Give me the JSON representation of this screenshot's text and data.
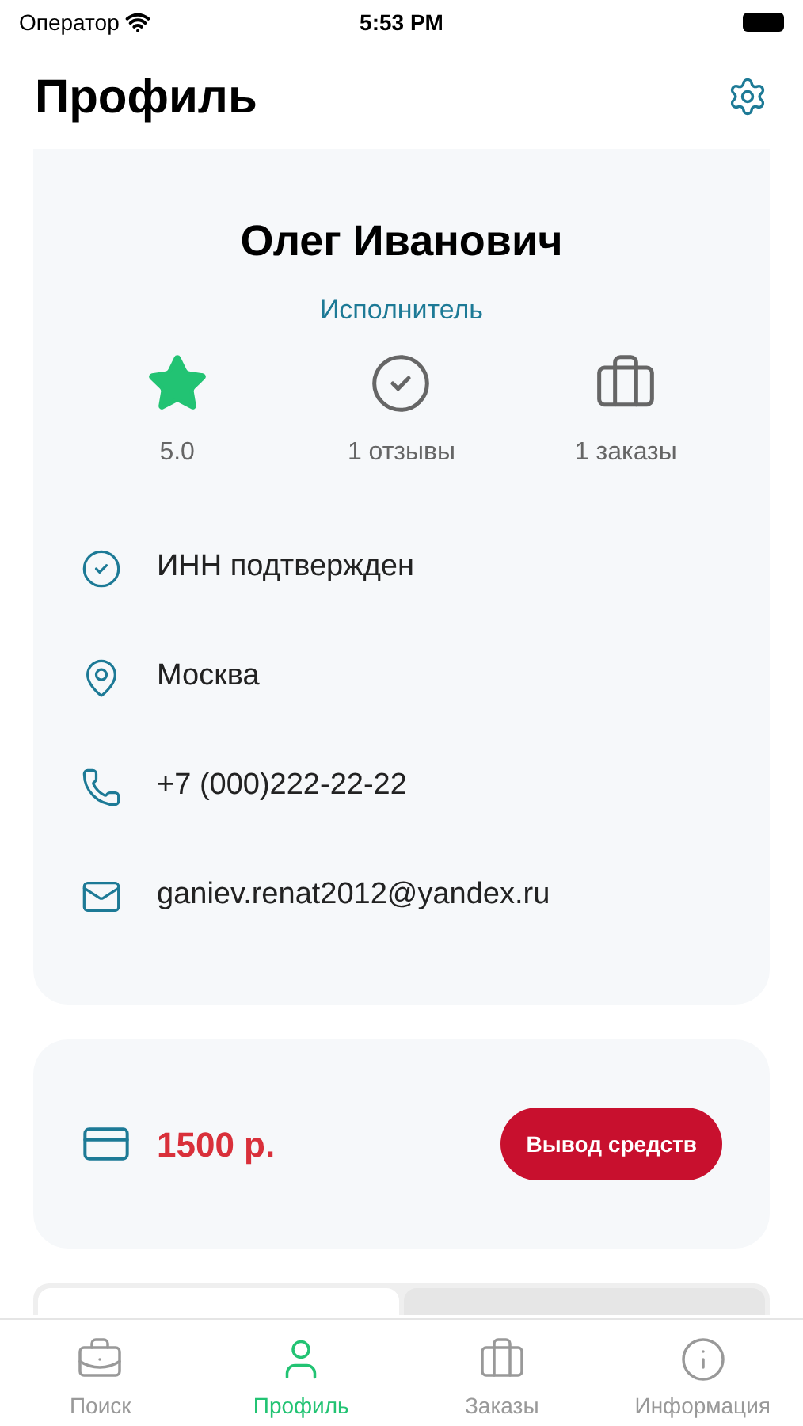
{
  "status_bar": {
    "carrier": "Оператор",
    "time": "5:53 PM"
  },
  "header": {
    "title": "Профиль"
  },
  "profile": {
    "name": "Олег Иванович",
    "role": "Исполнитель",
    "stats": [
      {
        "kind": "rating",
        "value": "5.0"
      },
      {
        "kind": "reviews",
        "value": "1 отзывы"
      },
      {
        "kind": "orders",
        "value": "1 заказы"
      }
    ],
    "details": [
      {
        "kind": "verified",
        "text": "ИНН подтвержден"
      },
      {
        "kind": "location",
        "text": "Москва"
      },
      {
        "kind": "phone",
        "text": "+7 (000)222-22-22"
      },
      {
        "kind": "email",
        "text": "ganiev.renat2012@yandex.ru"
      }
    ]
  },
  "balance": {
    "amount": "1500 р.",
    "button": "Вывод средств"
  },
  "segments": [
    {
      "selected": true
    },
    {
      "selected": false
    }
  ],
  "tab_bar": [
    {
      "kind": "search",
      "label": "Поиск",
      "selected": false
    },
    {
      "kind": "profile",
      "label": "Профиль",
      "selected": true
    },
    {
      "kind": "orders",
      "label": "Заказы",
      "selected": false
    },
    {
      "kind": "info",
      "label": "Информация",
      "selected": false
    }
  ]
}
